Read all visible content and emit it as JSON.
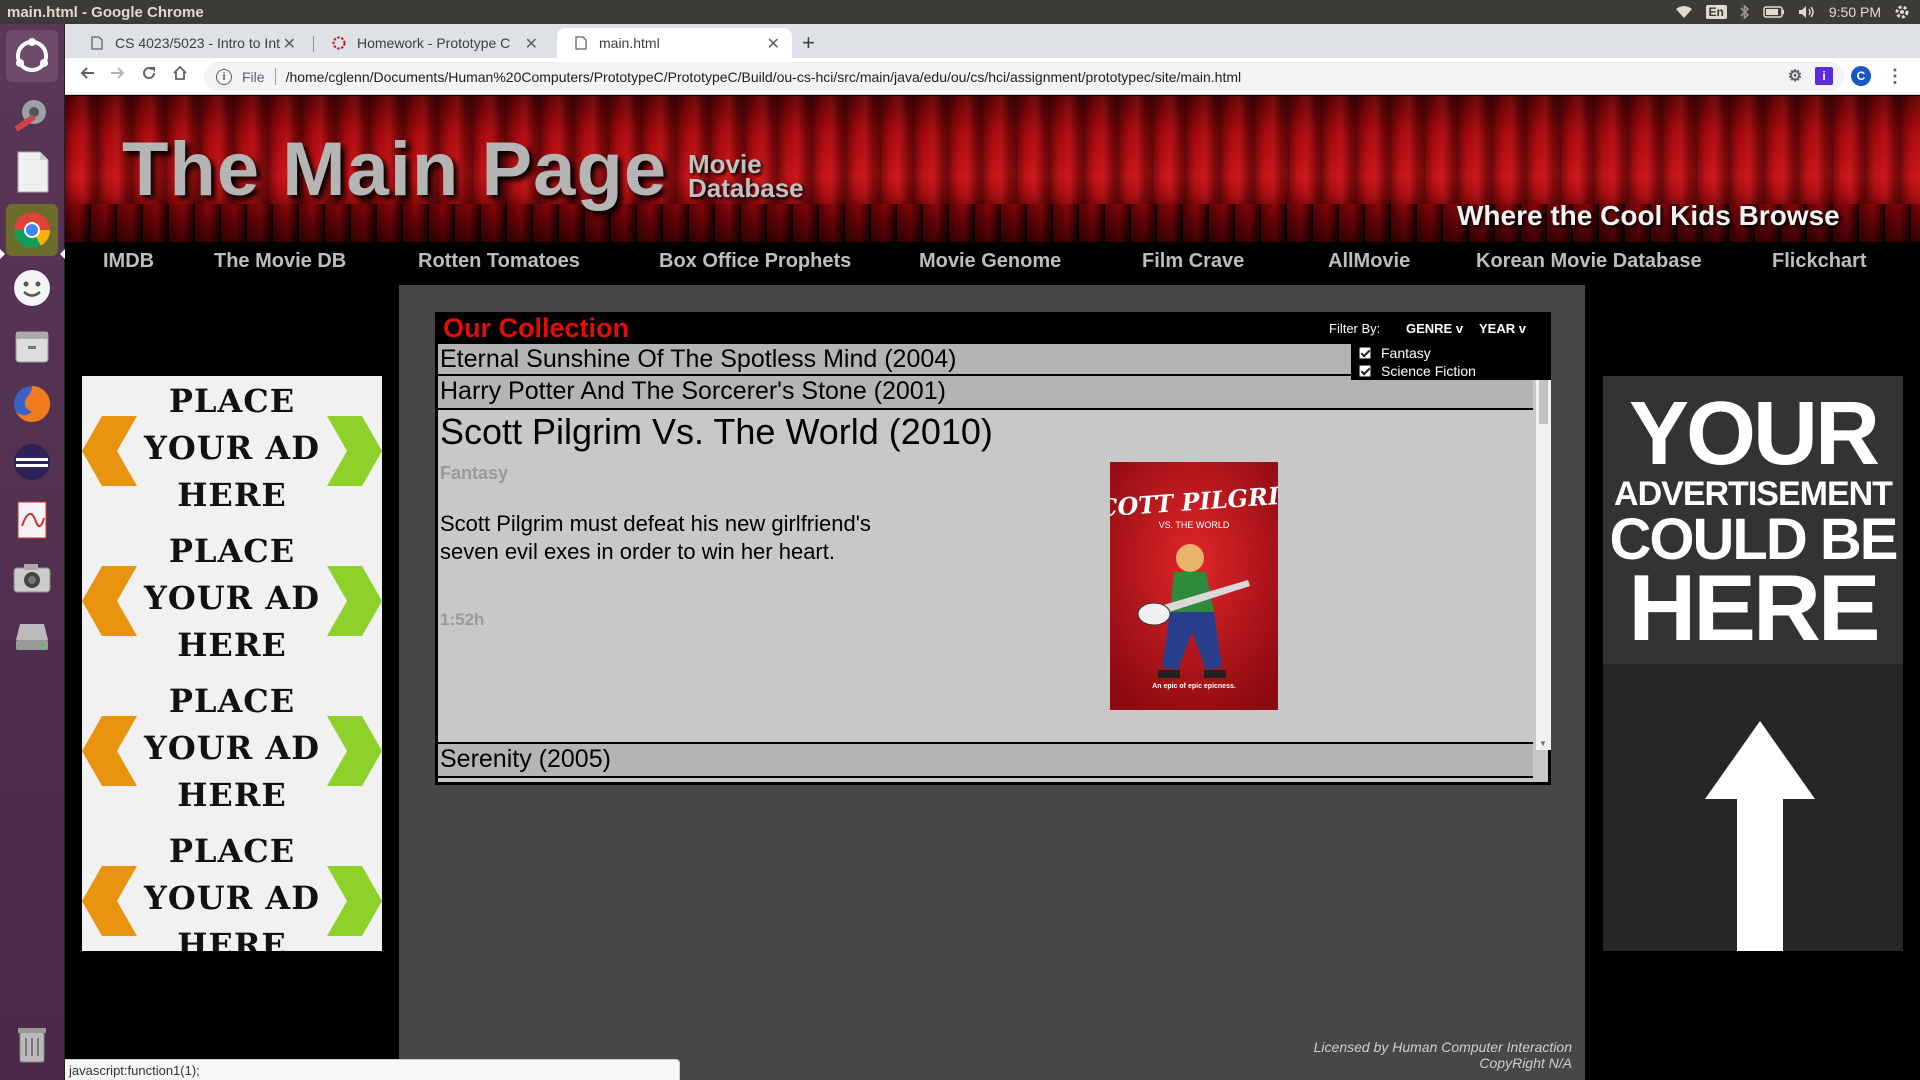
{
  "os": {
    "window_title": "main.html - Google Chrome",
    "keyboard_layout": "En",
    "clock": "9:50 PM"
  },
  "browser": {
    "tabs": [
      {
        "label": "CS 4023/5023 - Intro to Int",
        "icon": "document-icon",
        "active": false
      },
      {
        "label": "Homework - Prototype C",
        "icon": "ou-logo-icon",
        "active": false
      },
      {
        "label": "main.html",
        "icon": "document-icon",
        "active": true
      }
    ],
    "url_scheme": "File",
    "url": "/home/cglenn/Documents/Human%20Computers/PrototypeC/PrototypeC/Build/ou-cs-hci/src/main/java/edu/ou/cs/hci/assignment/prototypec/site/main.html",
    "profile_initial": "C",
    "extension_label": "i",
    "status_text": "javascript:function1(1);"
  },
  "site": {
    "title": "The Main Page",
    "subtitle_line1": "Movie",
    "subtitle_line2": "Database",
    "tagline": "Where the Cool Kids Browse",
    "nav": [
      "IMDB",
      "The Movie DB",
      "Rotten Tomatoes",
      "Box Office Prophets",
      "Movie Genome",
      "Film Crave",
      "AllMovie",
      "Korean Movie Database",
      "Flickchart"
    ],
    "ad_left": {
      "line1": "PLACE",
      "line2": "YOUR AD",
      "line3": "HERE"
    },
    "ad_right": {
      "line1": "YOUR",
      "line2": "ADVERTISEMENT",
      "line3": "COULD BE",
      "line4": "HERE"
    },
    "collection": {
      "title": "Our Collection",
      "filter_label": "Filter By:",
      "genre_button": "GENRE v",
      "year_button": "YEAR v",
      "genre_options": [
        {
          "label": "Fantasy",
          "checked": true
        },
        {
          "label": "Science Fiction",
          "checked": true
        }
      ],
      "movies": [
        {
          "title": "Eternal Sunshine Of The Spotless Mind (2004)"
        },
        {
          "title": "Harry Potter And The Sorcerer's Stone (2001)"
        },
        {
          "title": "Scott Pilgrim Vs. The World (2010)",
          "genre": "Fantasy",
          "description": "Scott Pilgrim must defeat his new girlfriend's seven evil exes in order to win her heart.",
          "duration": "1:52h",
          "poster_title": "SCOTT PILGRIM",
          "poster_sub": "VS. THE WORLD",
          "poster_tag": "An epic of epic epicness."
        },
        {
          "title": "Serenity (2005)"
        }
      ]
    },
    "footer_line1": "Licensed by Human Computer Interaction",
    "footer_line2": "CopyRight N/A"
  },
  "colors": {
    "accent_red": "#e10c0c",
    "panel_gray": "#474747",
    "row_gray": "#b4b4b4",
    "launcher": "#5a3657"
  }
}
